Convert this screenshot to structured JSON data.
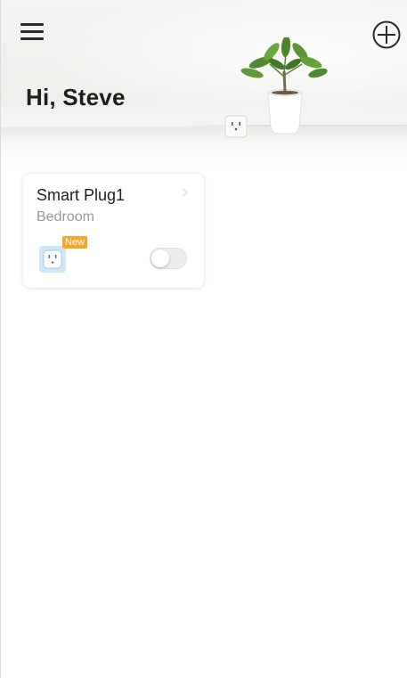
{
  "header": {
    "greeting": "Hi, Steve",
    "menu_icon": "hamburger-menu-icon",
    "add_icon": "circle-plus-icon"
  },
  "devices": [
    {
      "name": "Smart Plug1",
      "room": "Bedroom",
      "badge": "New",
      "icon": "smart-plug-icon",
      "power_on": false
    }
  ],
  "colors": {
    "badge": "#f2a62a",
    "icon_tint": "#cfe6f7",
    "text_primary": "#222222",
    "text_secondary": "#9a9a9a"
  }
}
